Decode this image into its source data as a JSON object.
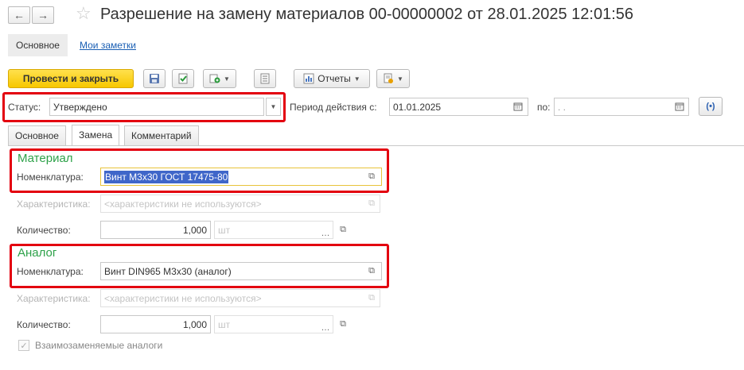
{
  "header": {
    "title": "Разрешение на замену материалов 00-00000002 от 28.01.2025 12:01:56",
    "back_glyph": "←",
    "forward_glyph": "→",
    "star_glyph": "☆"
  },
  "form_tabs": {
    "main": "Основное",
    "notes": "Мои заметки"
  },
  "toolbar": {
    "post_and_close": "Провести и закрыть",
    "reports": "Отчеты"
  },
  "filters": {
    "status_label": "Статус:",
    "status_value": "Утверждено",
    "period_label": "Период действия с:",
    "period_from": "01.01.2025",
    "period_to_label": "по:",
    "period_to": " .  ."
  },
  "tabs": {
    "main": "Основное",
    "replace": "Замена",
    "comment": "Комментарий"
  },
  "material": {
    "section_title": "Материал",
    "nomenclature_label": "Номенклатура:",
    "nomenclature_value": "Винт М3х30 ГОСТ 17475-80",
    "characteristic_label": "Характеристика:",
    "characteristic_placeholder": "<характеристики не используются>",
    "quantity_label": "Количество:",
    "quantity_value": "1,000",
    "unit_value": "шт"
  },
  "analog": {
    "section_title": "Аналог",
    "nomenclature_label": "Номенклатура:",
    "nomenclature_value": "Винт DIN965 M3x30 (аналог)",
    "characteristic_label": "Характеристика:",
    "characteristic_placeholder": "<характеристики не используются>",
    "quantity_label": "Количество:",
    "quantity_value": "1,000",
    "unit_value": "шт"
  },
  "interchangeable": {
    "label": "Взаимозаменяемые аналоги",
    "checked": true
  },
  "colors": {
    "accent_yellow": "#f7c700",
    "section_green": "#2ea24a",
    "highlight_red": "#e3000f",
    "selection_blue": "#3f66c9",
    "link_blue": "#1a5fb4"
  }
}
